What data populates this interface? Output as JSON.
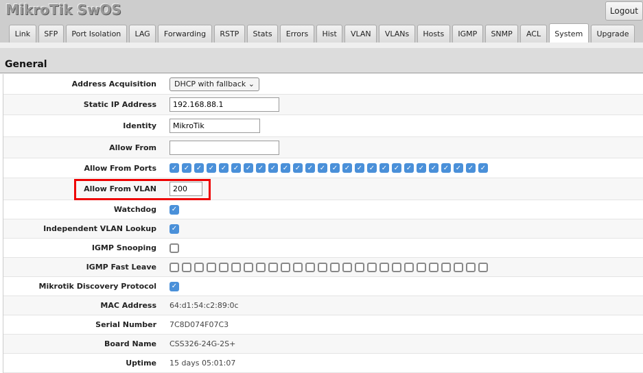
{
  "app": {
    "title": "MikroTik SwOS",
    "logout": "Logout"
  },
  "tabs": [
    "Link",
    "SFP",
    "Port Isolation",
    "LAG",
    "Forwarding",
    "RSTP",
    "Stats",
    "Errors",
    "Hist",
    "VLAN",
    "VLANs",
    "Hosts",
    "IGMP",
    "SNMP",
    "ACL",
    "System",
    "Upgrade"
  ],
  "active_tab": "System",
  "section": "General",
  "fields": {
    "address_acquisition": {
      "label": "Address Acquisition",
      "value": "DHCP with fallback"
    },
    "static_ip": {
      "label": "Static IP Address",
      "value": "192.168.88.1"
    },
    "identity": {
      "label": "Identity",
      "value": "MikroTik"
    },
    "allow_from": {
      "label": "Allow From",
      "value": ""
    },
    "allow_from_ports": {
      "label": "Allow From Ports",
      "checked": [
        true,
        true,
        true,
        true,
        true,
        true,
        true,
        true,
        true,
        true,
        true,
        true,
        true,
        true,
        true,
        true,
        true,
        true,
        true,
        true,
        true,
        true,
        true,
        true,
        true,
        true
      ]
    },
    "allow_from_vlan": {
      "label": "Allow From VLAN",
      "value": "200",
      "highlight": "#e00000"
    },
    "watchdog": {
      "label": "Watchdog",
      "checked": true
    },
    "ivl": {
      "label": "Independent VLAN Lookup",
      "checked": true
    },
    "igmp_snooping": {
      "label": "IGMP Snooping",
      "checked": false
    },
    "igmp_fast_leave": {
      "label": "IGMP Fast Leave",
      "checked": [
        false,
        false,
        false,
        false,
        false,
        false,
        false,
        false,
        false,
        false,
        false,
        false,
        false,
        false,
        false,
        false,
        false,
        false,
        false,
        false,
        false,
        false,
        false,
        false,
        false,
        false
      ]
    },
    "mdp": {
      "label": "Mikrotik Discovery Protocol",
      "checked": true
    },
    "mac": {
      "label": "MAC Address",
      "value": "64:d1:54:c2:89:0c"
    },
    "serial": {
      "label": "Serial Number",
      "value": "7C8D074F07C3"
    },
    "board": {
      "label": "Board Name",
      "value": "CSS326-24G-2S+"
    },
    "uptime": {
      "label": "Uptime",
      "value": "15 days 05:01:07"
    }
  },
  "colors": {
    "checkbox": "#4a90d9",
    "header": "#cdcdcd"
  }
}
